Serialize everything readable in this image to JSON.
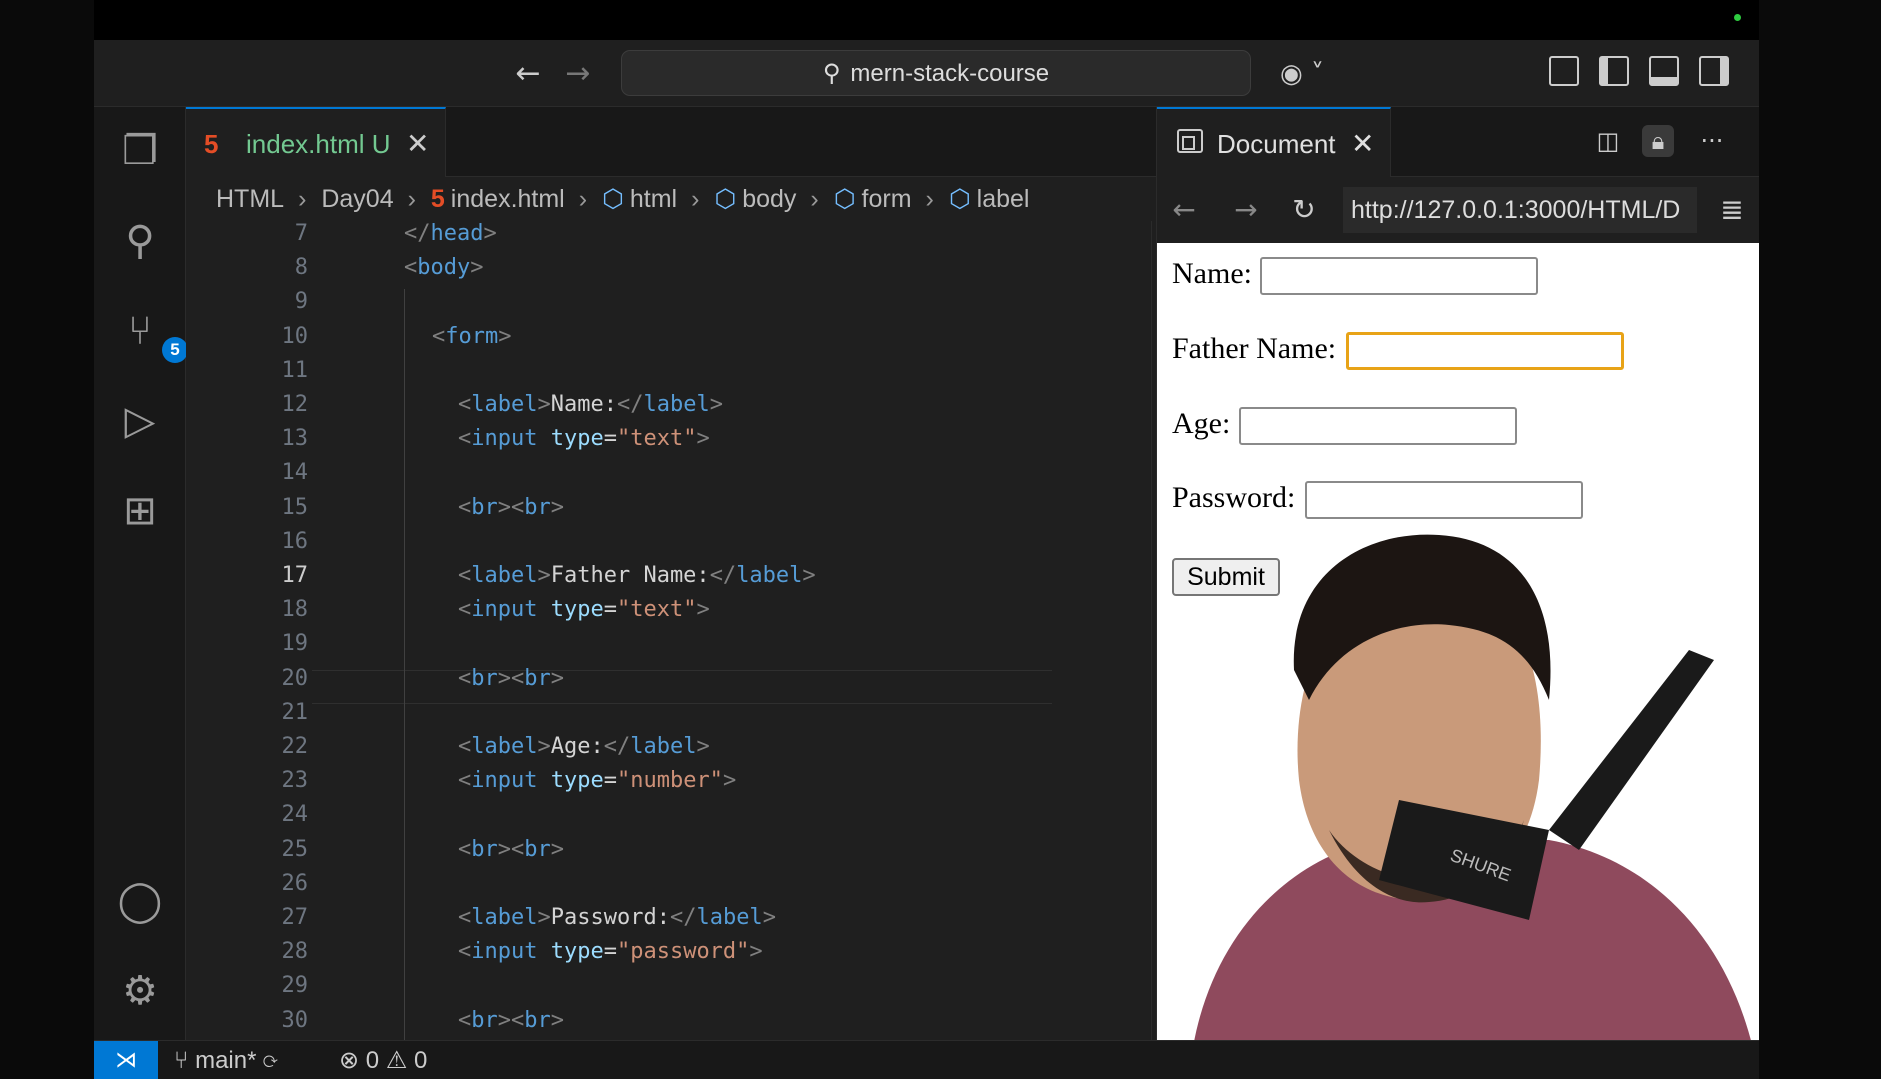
{
  "titlebar": {
    "search_text": "mern-stack-course"
  },
  "activity_bar": {
    "scm_badge": "5"
  },
  "editor": {
    "tab": {
      "icon_text": "5",
      "filename": "index.html",
      "status": "U"
    },
    "breadcrumb": [
      "HTML",
      "Day04",
      "index.html",
      "html",
      "body",
      "form",
      "label"
    ],
    "lines": [
      {
        "n": "7",
        "active": false,
        "parts": [
          [
            "b",
            "</"
          ],
          [
            "t",
            "head"
          ],
          [
            "b",
            ">"
          ]
        ],
        "indent": 0
      },
      {
        "n": "8",
        "active": false,
        "parts": [
          [
            "b",
            "<"
          ],
          [
            "t",
            "body"
          ],
          [
            "b",
            ">"
          ]
        ],
        "indent": 0
      },
      {
        "n": "9",
        "active": false,
        "parts": [],
        "indent": 0
      },
      {
        "n": "10",
        "active": false,
        "parts": [
          [
            "b",
            "<"
          ],
          [
            "t",
            "form"
          ],
          [
            "b",
            ">"
          ]
        ],
        "indent": 1
      },
      {
        "n": "11",
        "active": false,
        "parts": [],
        "indent": 0
      },
      {
        "n": "12",
        "active": false,
        "parts": [
          [
            "b",
            "<"
          ],
          [
            "t",
            "label"
          ],
          [
            "b",
            ">"
          ],
          [
            "x",
            "Name:"
          ],
          [
            "b",
            "</"
          ],
          [
            "t",
            "label"
          ],
          [
            "b",
            ">"
          ]
        ],
        "indent": 2
      },
      {
        "n": "13",
        "active": false,
        "parts": [
          [
            "b",
            "<"
          ],
          [
            "t",
            "input"
          ],
          [
            "x",
            " "
          ],
          [
            "a",
            "type"
          ],
          [
            "x",
            "="
          ],
          [
            "s",
            "\"text\""
          ],
          [
            "b",
            ">"
          ]
        ],
        "indent": 2
      },
      {
        "n": "14",
        "active": false,
        "parts": [],
        "indent": 0
      },
      {
        "n": "15",
        "active": false,
        "parts": [
          [
            "b",
            "<"
          ],
          [
            "t",
            "br"
          ],
          [
            "b",
            "><"
          ],
          [
            "t",
            "br"
          ],
          [
            "b",
            ">"
          ]
        ],
        "indent": 2
      },
      {
        "n": "16",
        "active": false,
        "parts": [],
        "indent": 0
      },
      {
        "n": "17",
        "active": true,
        "parts": [
          [
            "b",
            "<"
          ],
          [
            "t",
            "label"
          ],
          [
            "b",
            ">"
          ],
          [
            "x",
            "Father Name:"
          ],
          [
            "b",
            "</"
          ],
          [
            "t",
            "label"
          ],
          [
            "b",
            ">"
          ]
        ],
        "indent": 2
      },
      {
        "n": "18",
        "active": false,
        "parts": [
          [
            "b",
            "<"
          ],
          [
            "t",
            "input"
          ],
          [
            "x",
            " "
          ],
          [
            "a",
            "type"
          ],
          [
            "x",
            "="
          ],
          [
            "s",
            "\"text\""
          ],
          [
            "b",
            ">"
          ]
        ],
        "indent": 2
      },
      {
        "n": "19",
        "active": false,
        "parts": [],
        "indent": 0
      },
      {
        "n": "20",
        "active": false,
        "parts": [
          [
            "b",
            "<"
          ],
          [
            "t",
            "br"
          ],
          [
            "b",
            "><"
          ],
          [
            "t",
            "br"
          ],
          [
            "b",
            ">"
          ]
        ],
        "indent": 2
      },
      {
        "n": "21",
        "active": false,
        "parts": [],
        "indent": 0
      },
      {
        "n": "22",
        "active": false,
        "parts": [
          [
            "b",
            "<"
          ],
          [
            "t",
            "label"
          ],
          [
            "b",
            ">"
          ],
          [
            "x",
            "Age:"
          ],
          [
            "b",
            "</"
          ],
          [
            "t",
            "label"
          ],
          [
            "b",
            ">"
          ]
        ],
        "indent": 2
      },
      {
        "n": "23",
        "active": false,
        "parts": [
          [
            "b",
            "<"
          ],
          [
            "t",
            "input"
          ],
          [
            "x",
            " "
          ],
          [
            "a",
            "type"
          ],
          [
            "x",
            "="
          ],
          [
            "s",
            "\"number\""
          ],
          [
            "b",
            ">"
          ]
        ],
        "indent": 2
      },
      {
        "n": "24",
        "active": false,
        "parts": [],
        "indent": 0
      },
      {
        "n": "25",
        "active": false,
        "parts": [
          [
            "b",
            "<"
          ],
          [
            "t",
            "br"
          ],
          [
            "b",
            "><"
          ],
          [
            "t",
            "br"
          ],
          [
            "b",
            ">"
          ]
        ],
        "indent": 2
      },
      {
        "n": "26",
        "active": false,
        "parts": [],
        "indent": 0
      },
      {
        "n": "27",
        "active": false,
        "parts": [
          [
            "b",
            "<"
          ],
          [
            "t",
            "label"
          ],
          [
            "b",
            ">"
          ],
          [
            "x",
            "Password:"
          ],
          [
            "b",
            "</"
          ],
          [
            "t",
            "label"
          ],
          [
            "b",
            ">"
          ]
        ],
        "indent": 2
      },
      {
        "n": "28",
        "active": false,
        "parts": [
          [
            "b",
            "<"
          ],
          [
            "t",
            "input"
          ],
          [
            "x",
            " "
          ],
          [
            "a",
            "type"
          ],
          [
            "x",
            "="
          ],
          [
            "s",
            "\"password\""
          ],
          [
            "b",
            ">"
          ]
        ],
        "indent": 2
      },
      {
        "n": "29",
        "active": false,
        "parts": [],
        "indent": 0
      },
      {
        "n": "30",
        "active": false,
        "parts": [
          [
            "b",
            "<"
          ],
          [
            "t",
            "br"
          ],
          [
            "b",
            "><"
          ],
          [
            "t",
            "br"
          ],
          [
            "b",
            ">"
          ]
        ],
        "indent": 2
      }
    ]
  },
  "preview": {
    "tab_title": "Document",
    "url": "http://127.0.0.1:3000/HTML/D",
    "form": {
      "name_label": "Name:",
      "father_label": "Father Name:",
      "age_label": "Age:",
      "password_label": "Password:",
      "submit_label": "Submit",
      "focused_field": "Father Name:"
    }
  },
  "statusbar": {
    "branch": "main*",
    "errors": "0",
    "warnings": "0"
  },
  "colors": {
    "accent": "#0078d4",
    "focus_outline": "#e8a317",
    "html_icon": "#e44d26",
    "untracked_file": "#73c991"
  },
  "icons": [
    "back-arrow-icon",
    "forward-arrow-icon",
    "search-icon",
    "copilot-icon",
    "explorer-icon",
    "search-icon",
    "source-control-icon",
    "run-debug-icon",
    "extensions-icon",
    "account-icon",
    "settings-gear-icon",
    "html5-icon",
    "close-icon",
    "ellipsis-icon",
    "symbol-icon",
    "document-icon",
    "split-editor-icon",
    "lock-icon",
    "reload-icon",
    "menu-icon",
    "remote-icon",
    "git-branch-icon",
    "sync-icon",
    "error-icon",
    "warning-icon"
  ]
}
